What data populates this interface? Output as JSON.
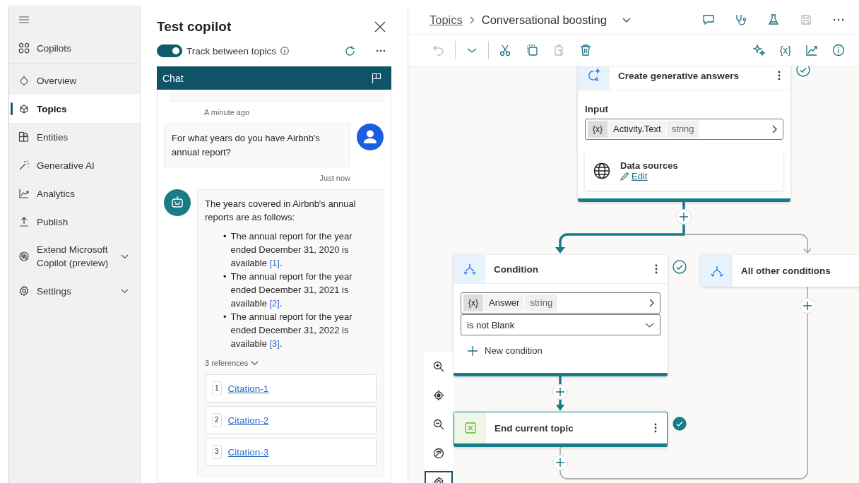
{
  "sidebar": {
    "items": [
      {
        "label": "Copilots",
        "kind": "grid",
        "selected": false,
        "has_submenu": false
      },
      {
        "label": "Overview",
        "kind": "dial",
        "selected": false,
        "has_submenu": false
      },
      {
        "label": "Topics",
        "kind": "cubes",
        "selected": true,
        "has_submenu": false
      },
      {
        "label": "Entities",
        "kind": "blocks",
        "selected": false,
        "has_submenu": false
      },
      {
        "label": "Generative AI",
        "kind": "wand",
        "selected": false,
        "has_submenu": false
      },
      {
        "label": "Analytics",
        "kind": "chart",
        "selected": false,
        "has_submenu": false
      },
      {
        "label": "Publish",
        "kind": "upload",
        "selected": false,
        "has_submenu": false
      },
      {
        "label": "Extend Microsoft Copilot (preview)",
        "kind": "extend",
        "selected": false,
        "has_submenu": true
      },
      {
        "label": "Settings",
        "kind": "gear",
        "selected": false,
        "has_submenu": true
      }
    ]
  },
  "test_panel": {
    "title": "Test copilot",
    "toggle": {
      "label": "Track between topics",
      "on": true
    },
    "chat_header": "Chat",
    "messages": [
      {
        "kind": "bot-tail",
        "time": "A minute ago"
      },
      {
        "kind": "user",
        "text": "For what years do you have Airbnb's annual report?",
        "time": "Just now"
      },
      {
        "kind": "bot",
        "intro": "The years covered in Airbnb's annual reports are as follows:",
        "bullets": [
          {
            "marker": "•",
            "text": "The annual report for the year ended December 31, 2020 is available",
            "ref": "[1]",
            "end": "."
          },
          {
            "marker": "•",
            "text": "The annual report for the year ended December 31, 2021 is available",
            "ref": "[2]",
            "end": "."
          },
          {
            "marker": "•",
            "text": "The annual report for the year ended December 31, 2022 is available",
            "ref": "[3]",
            "end": "."
          }
        ],
        "references_label": "3 references",
        "expanded": true,
        "citations": [
          {
            "number": "1",
            "label": "Citation-1"
          },
          {
            "number": "2",
            "label": "Citation-2"
          },
          {
            "number": "3",
            "label": "Citation-3"
          }
        ]
      }
    ]
  },
  "editor": {
    "breadcrumb": {
      "parent": "Topics",
      "current": "Conversational boosting"
    },
    "header_actions": [
      {
        "kind": "comment",
        "disabled": false
      },
      {
        "kind": "stethoscope",
        "disabled": false
      },
      {
        "kind": "flask",
        "disabled": false
      },
      {
        "kind": "save",
        "disabled": true
      },
      {
        "kind": "more",
        "disabled": false
      }
    ],
    "toolbar_left": [
      {
        "kind": "undo",
        "disabled": true
      },
      {
        "kind": "chevron",
        "disabled": false
      },
      {
        "kind": "cut",
        "disabled": false
      },
      {
        "kind": "copy",
        "disabled": false
      },
      {
        "kind": "paste",
        "disabled": true
      },
      {
        "kind": "delete",
        "disabled": false
      }
    ],
    "toolbar_right": [
      {
        "kind": "sparkle"
      },
      {
        "kind": "text",
        "text": "{x}"
      },
      {
        "kind": "chart"
      },
      {
        "kind": "info"
      }
    ],
    "nodes": {
      "generative": {
        "title": "Create generative answers",
        "completed": false,
        "input_label": "Input",
        "variable": {
          "badge": "{x}",
          "name": "Activity.Text",
          "type": "string"
        },
        "data_sources": {
          "title": "Data sources",
          "link": "Edit"
        }
      },
      "condition": {
        "title": "Condition",
        "completed": false,
        "variable": {
          "badge": "{x}",
          "name": "Answer",
          "type": "string"
        },
        "operator": "is not Blank",
        "add": "New condition"
      },
      "other": {
        "title": "All other conditions"
      },
      "end": {
        "title": "End current topic",
        "completed": true
      }
    },
    "zoom_controls": [
      {
        "kind": "zoom-in"
      },
      {
        "kind": "focus"
      },
      {
        "kind": "zoom-out"
      },
      {
        "kind": "hide"
      },
      {
        "kind": "settings"
      }
    ]
  }
}
